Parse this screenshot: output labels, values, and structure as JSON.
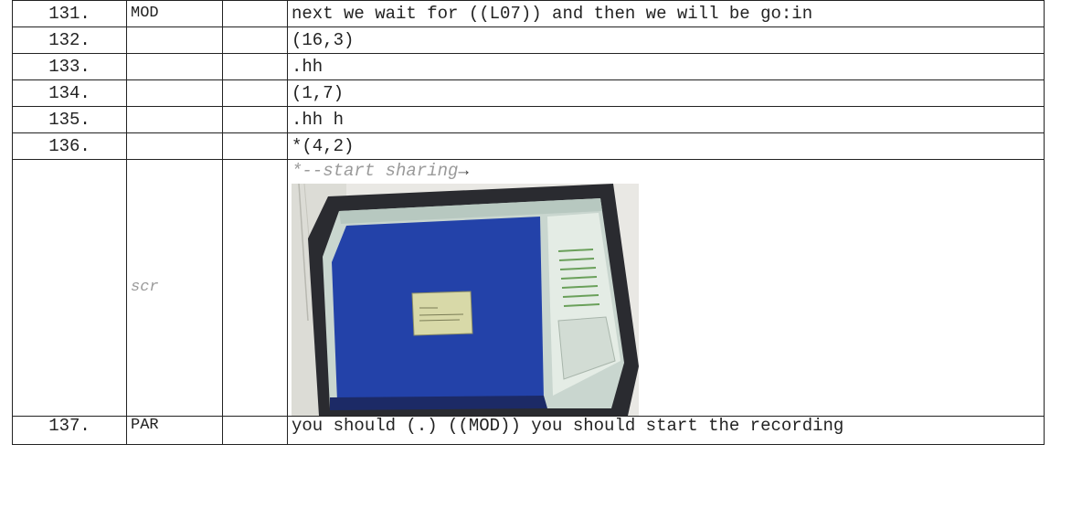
{
  "rows": [
    {
      "num": "131.",
      "speaker": "MOD",
      "text": "next we wait for ((L07)) and then we will be go:in"
    },
    {
      "num": "132.",
      "speaker": "",
      "text": "(16,3)"
    },
    {
      "num": "133.",
      "speaker": "",
      "text": ".hh"
    },
    {
      "num": "134.",
      "speaker": "",
      "text": "(1,7)"
    },
    {
      "num": "135.",
      "speaker": "",
      "text": ".hh h"
    },
    {
      "num": "136.",
      "speaker": "",
      "text": "*(4,2)"
    }
  ],
  "screen_row": {
    "label": "scr",
    "annotation": "*--start sharing",
    "arrow": "→",
    "image_desc_icon": "monitor-photo"
  },
  "last_row": {
    "num": "137.",
    "speaker": "PAR",
    "text": "you should (.) ((MOD)) you should start the recording"
  },
  "colors": {
    "border": "#222222",
    "annotation": "#9a9a9a",
    "screen_blue": "#1f3fa8",
    "desktop_dialog": "#d8d9a8"
  }
}
